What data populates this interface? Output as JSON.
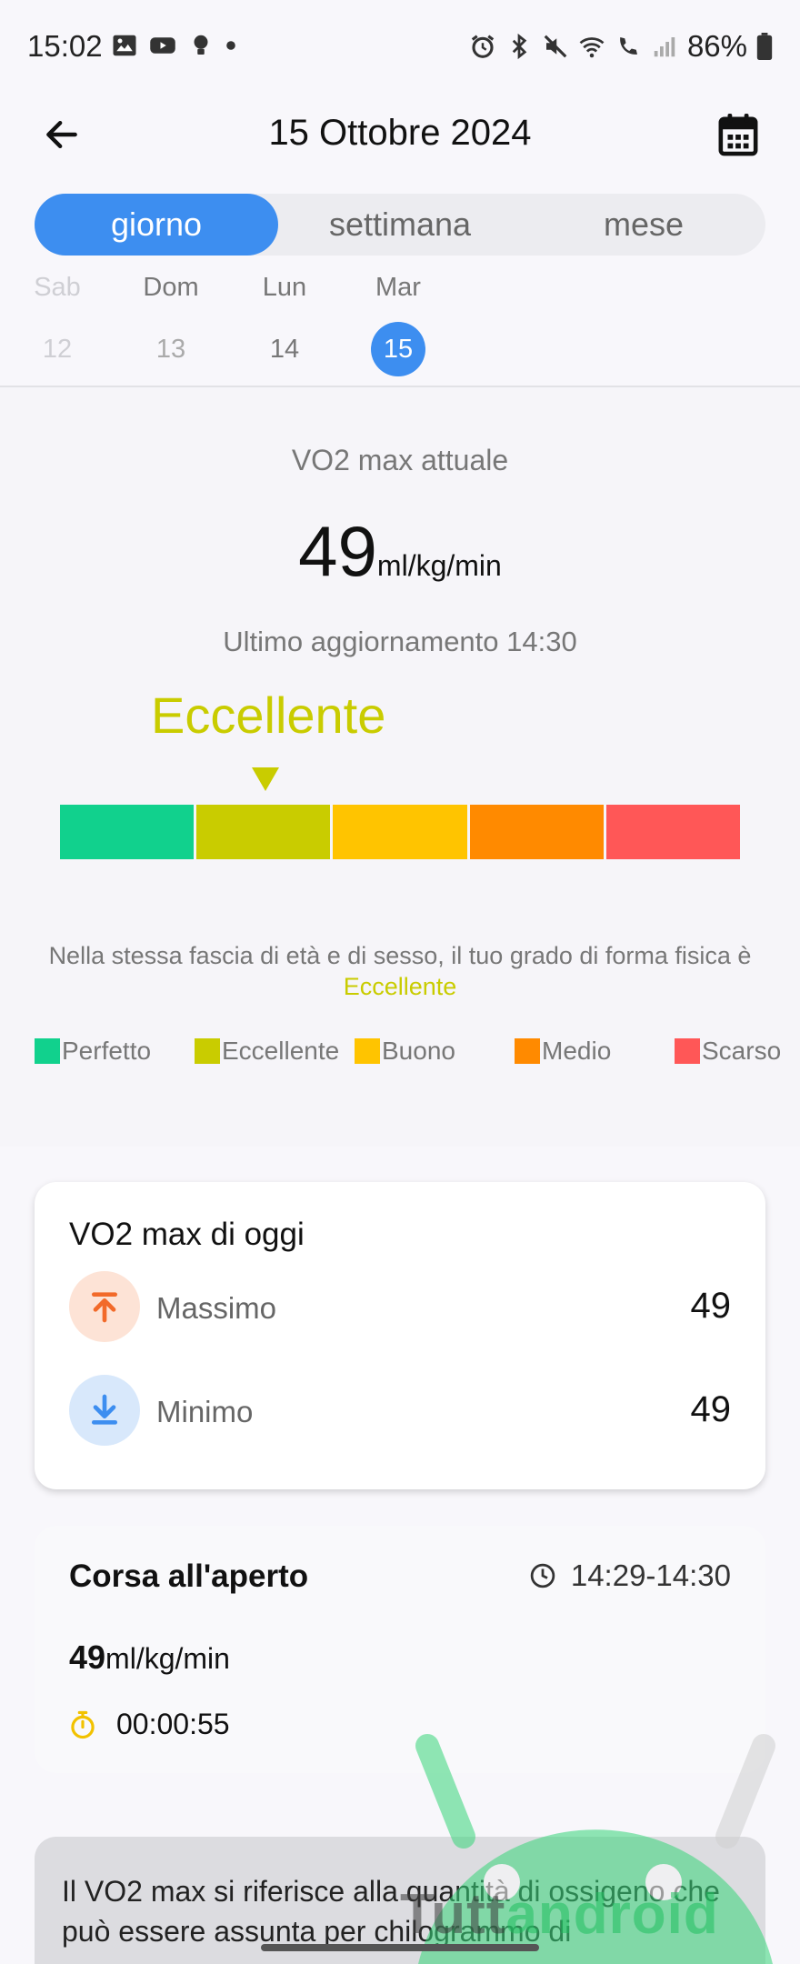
{
  "status_bar": {
    "time": "15:02",
    "battery": "86%"
  },
  "header": {
    "date_title": "15 Ottobre 2024"
  },
  "tabs": [
    {
      "label": "giorno",
      "active": true
    },
    {
      "label": "settimana",
      "active": false
    },
    {
      "label": "mese",
      "active": false
    }
  ],
  "days": [
    {
      "dow": "Sab",
      "num": "12"
    },
    {
      "dow": "Dom",
      "num": "13"
    },
    {
      "dow": "Lun",
      "num": "14"
    },
    {
      "dow": "Mar",
      "num": "15"
    }
  ],
  "summary": {
    "label": "VO2 max attuale",
    "value": "49",
    "unit": "ml/kg/min",
    "updated": "Ultimo aggiornamento 14:30",
    "grade": "Eccellente",
    "note_prefix": "Nella stessa fascia di età e di sesso, il tuo grado di forma fisica è ",
    "note_grade": "Eccellente",
    "colors": {
      "perfetto": "#11d18d",
      "eccellente": "#c9cc00",
      "buono": "#ffc400",
      "medio": "#ff8a00",
      "scarso": "#ff5757",
      "accent": "#3d8ef0"
    },
    "legend": [
      "Perfetto",
      "Eccellente",
      "Buono",
      "Medio",
      "Scarso"
    ]
  },
  "today": {
    "title": "VO2 max di oggi",
    "max_label": "Massimo",
    "max_value": "49",
    "min_label": "Minimo",
    "min_value": "49"
  },
  "run": {
    "title": "Corsa all'aperto",
    "time": "14:29-14:30",
    "vo2": "49",
    "unit": "ml/kg/min",
    "duration": "00:00:55"
  },
  "info": {
    "text": "Il VO2 max si riferisce alla quantità di ossigeno che può essere assunta per chilogrammo di"
  },
  "watermark": {
    "part1": "Tutt",
    "part2": "android"
  }
}
